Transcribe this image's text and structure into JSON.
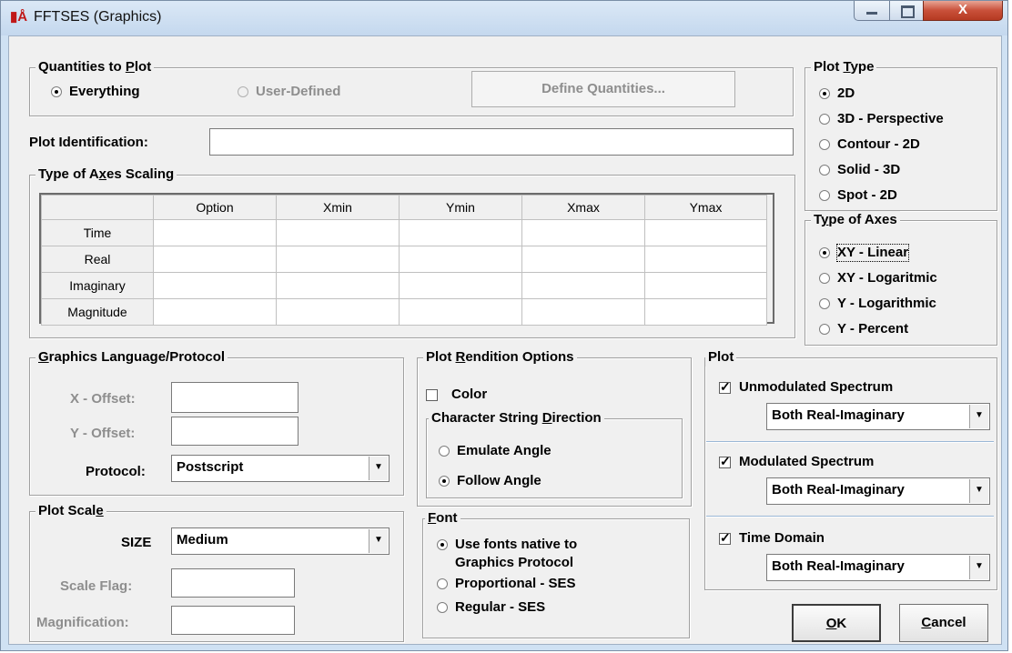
{
  "window": {
    "title": "FFTSES (Graphics)",
    "close_glyph": "X"
  },
  "quantities": {
    "legend_pre": "Quantities to ",
    "legend_key": "P",
    "legend_post": "lot",
    "everything": "Everything",
    "user_defined": "User-Defined",
    "define_button": "Define Quantities..."
  },
  "plot_identification": {
    "label": "Plot Identification:",
    "value": ""
  },
  "axes_scaling": {
    "legend_pre": "Type of A",
    "legend_key": "x",
    "legend_post": "es Scaling",
    "columns": [
      "Option",
      "Xmin",
      "Ymin",
      "Xmax",
      "Ymax"
    ],
    "rows": [
      "Time",
      "Real",
      "Imaginary",
      "Magnitude"
    ]
  },
  "plot_type": {
    "legend_pre": "Plot ",
    "legend_key": "T",
    "legend_post": "ype",
    "options": [
      "2D",
      "3D - Perspective",
      "Contour - 2D",
      "Solid - 3D",
      "Spot - 2D"
    ],
    "selected": "2D"
  },
  "type_of_axes": {
    "legend_pre": "T",
    "legend_key": "y",
    "legend_post": "pe of Axes",
    "options": [
      "XY - Linear",
      "XY - Logaritmic",
      "Y - Logarithmic",
      "Y - Percent"
    ],
    "selected": "XY - Linear"
  },
  "graphics_language": {
    "legend_key": "G",
    "legend_post": "raphics Language/Protocol",
    "x_offset": "X - Offset:",
    "y_offset": "Y - Offset:",
    "protocol_label": "Protocol:",
    "protocol_value": "Postscript"
  },
  "plot_scale": {
    "legend_pre": "Plot Scal",
    "legend_key": "e",
    "legend_post": "",
    "size_label": "SIZE",
    "size_value": "Medium",
    "scale_flag": "Scale Flag:",
    "magnification": "Magnification:"
  },
  "rendition": {
    "legend_pre": "Plot ",
    "legend_key": "R",
    "legend_post": "endition Options",
    "color": "Color",
    "direction_legend_pre": "Character String ",
    "direction_legend_key": "D",
    "direction_legend_post": "irection",
    "emulate": "Emulate Angle",
    "follow": "Follow Angle"
  },
  "font": {
    "legend_key": "F",
    "legend_post": "ont",
    "native_line1": "Use fonts native to",
    "native_line2": "Graphics Protocol",
    "proportional": "Proportional - SES",
    "regular": "Regular - SES"
  },
  "plot": {
    "legend": "Plot",
    "unmodulated": "Unmodulated Spectrum",
    "unmodulated_mode": "Both Real-Imaginary",
    "modulated": "Modulated Spectrum",
    "modulated_mode": "Both Real-Imaginary",
    "time_domain": "Time Domain",
    "time_domain_mode": "Both Real-Imaginary"
  },
  "buttons": {
    "ok_key": "O",
    "ok_rest": "K",
    "cancel_key": "C",
    "cancel_rest": "ancel"
  }
}
